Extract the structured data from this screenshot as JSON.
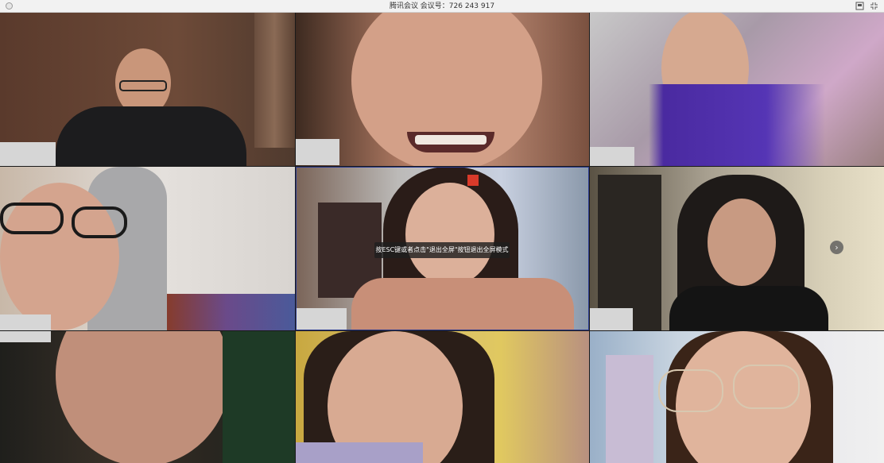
{
  "window": {
    "title": "腾讯会议  会议号：726 243 917"
  },
  "tooltip": {
    "text": "按ESC键或者点击\"退出全屏\"按钮退出全屏模式"
  },
  "icons": {
    "close": "close-circle-icon",
    "pin": "pin-icon",
    "exit_fullscreen": "exit-fullscreen-icon",
    "next": "chevron-right-icon"
  },
  "colors": {
    "titlebar": "#f2f2f2",
    "active_speaker_border": "#2b3a8f",
    "name_label_bg": "#d6d6d6"
  }
}
